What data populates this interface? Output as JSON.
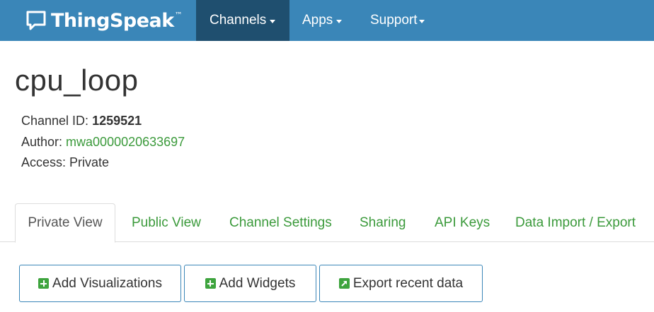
{
  "nav": {
    "brand": "ThingSpeak",
    "brand_tm": "™",
    "items": [
      {
        "label": "Channels"
      },
      {
        "label": "Apps"
      },
      {
        "label": "Support"
      }
    ]
  },
  "channel": {
    "title": "cpu_loop",
    "id_label": "Channel ID: ",
    "id_value": "1259521",
    "author_label": "Author: ",
    "author_value": "mwa0000020633697",
    "access_label": "Access: ",
    "access_value": "Private"
  },
  "tabs": [
    {
      "label": "Private View"
    },
    {
      "label": "Public View"
    },
    {
      "label": "Channel Settings"
    },
    {
      "label": "Sharing"
    },
    {
      "label": "API Keys"
    },
    {
      "label": "Data Import / Export"
    }
  ],
  "actions": {
    "add_visualizations": "Add Visualizations",
    "add_widgets": "Add Widgets",
    "export_recent": "Export recent data"
  },
  "colors": {
    "navbar": "#3a86b8",
    "nav_active": "#1f4f6f",
    "link_green": "#3b9a3b",
    "icon_green": "#3ea43e"
  }
}
